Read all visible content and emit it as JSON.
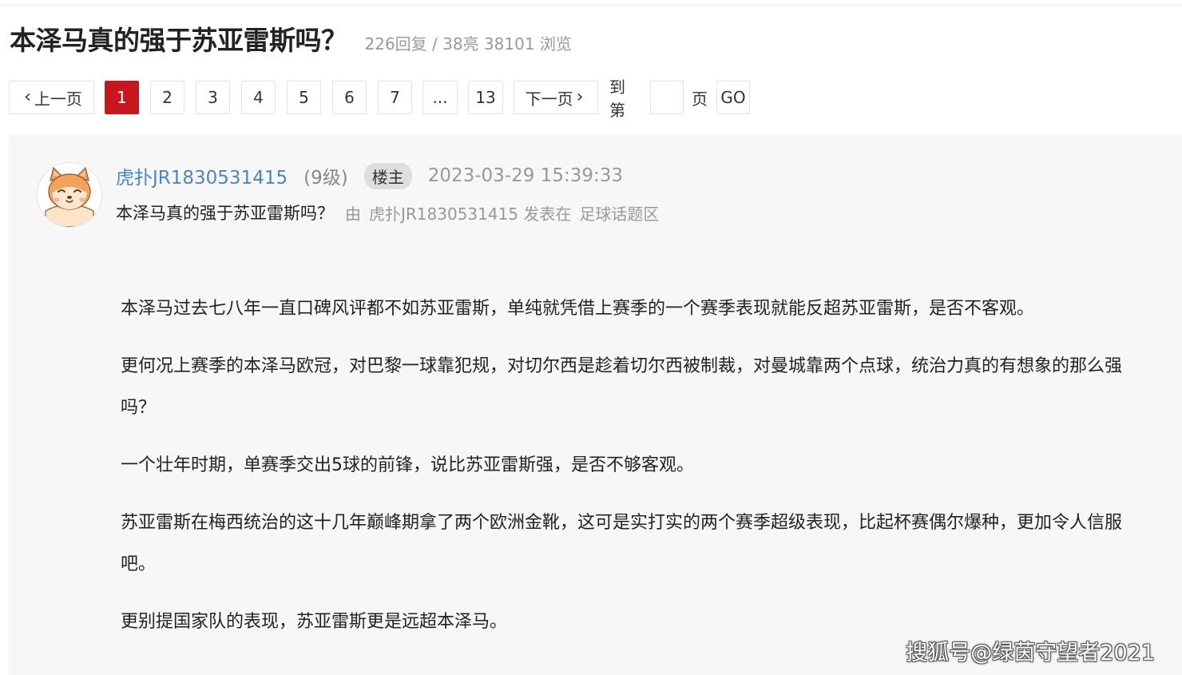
{
  "thread": {
    "title": "本泽马真的强于苏亚雷斯吗？",
    "stats": "226回复 / 38亮 38101 浏览"
  },
  "pager": {
    "prev_label": "上一页",
    "pages": [
      "1",
      "2",
      "3",
      "4",
      "5",
      "6",
      "7",
      "...",
      "13"
    ],
    "current_page": "1",
    "next_label": "下一页",
    "goto_prefix": "到第",
    "goto_input_value": "",
    "goto_suffix": "页",
    "go_label": "GO"
  },
  "post": {
    "username": "虎扑JR1830531415",
    "level": "(9级)",
    "op_badge": "楼主",
    "time": "2023-03-29 15:39:33",
    "subtitle": "本泽马真的强于苏亚雷斯吗？",
    "by_text": "由",
    "author": "虎扑JR1830531415 发表在",
    "board": "足球话题区",
    "paragraphs": [
      "本泽马过去七八年一直口碑风评都不如苏亚雷斯，单纯就凭借上赛季的一个赛季表现就能反超苏亚雷斯，是否不客观。",
      "更何况上赛季的本泽马欧冠，对巴黎一球靠犯规，对切尔西是趁着切尔西被制裁，对曼城靠两个点球，统治力真的有想象的那么强吗？",
      "一个壮年时期，单赛季交出5球的前锋，说比苏亚雷斯强，是否不够客观。",
      "苏亚雷斯在梅西统治的这十几年巅峰期拿了两个欧洲金靴，这可是实打实的两个赛季超级表现，比起杯赛偶尔爆种，更加令人信服吧。",
      "更别提国家队的表现，苏亚雷斯更是远超本泽马。"
    ]
  },
  "watermark": "搜狐号@绿茵守望者2021",
  "colors": {
    "accent_red": "#c8161e",
    "username_blue": "#4a86c5",
    "panel_bg": "#f7f7f7",
    "muted_gray": "#999999"
  },
  "icons": {
    "prev": "chevron-left-icon",
    "next": "chevron-right-icon",
    "avatar": "fox-avatar-icon"
  }
}
